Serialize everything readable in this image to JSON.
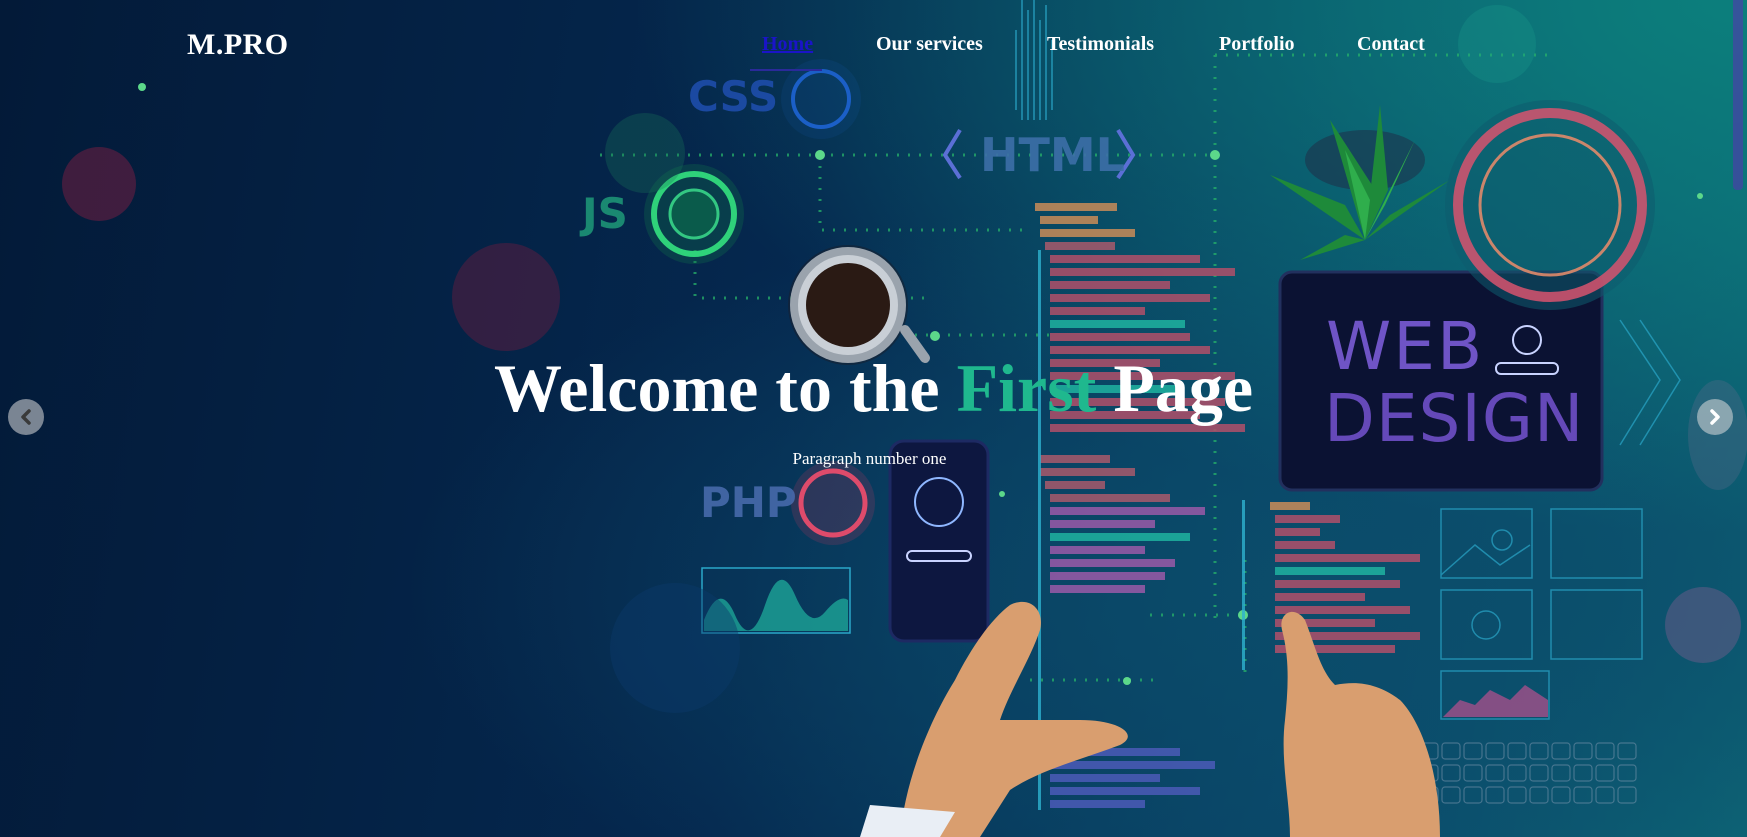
{
  "brand": {
    "logo": "M.PRO"
  },
  "nav": {
    "items": [
      {
        "label": "Home",
        "active": true
      },
      {
        "label": "Our services",
        "active": false
      },
      {
        "label": "Testimonials",
        "active": false
      },
      {
        "label": "Portfolio",
        "active": false
      },
      {
        "label": "Contact",
        "active": false
      }
    ]
  },
  "hero": {
    "title_part1": "Welcome to the",
    "title_accent": "First",
    "title_part2": "Page",
    "subtitle": "Paragraph number one",
    "accent_color": "#1fb88e"
  },
  "background_art": {
    "css_label": "CSS",
    "html_label": "HTML",
    "js_label": "JS",
    "php_label": "PHP",
    "web_label": "WEB",
    "design_label": "DESIGN"
  },
  "carousel": {
    "prev_icon": "chevron-left-icon",
    "next_icon": "chevron-right-icon"
  }
}
